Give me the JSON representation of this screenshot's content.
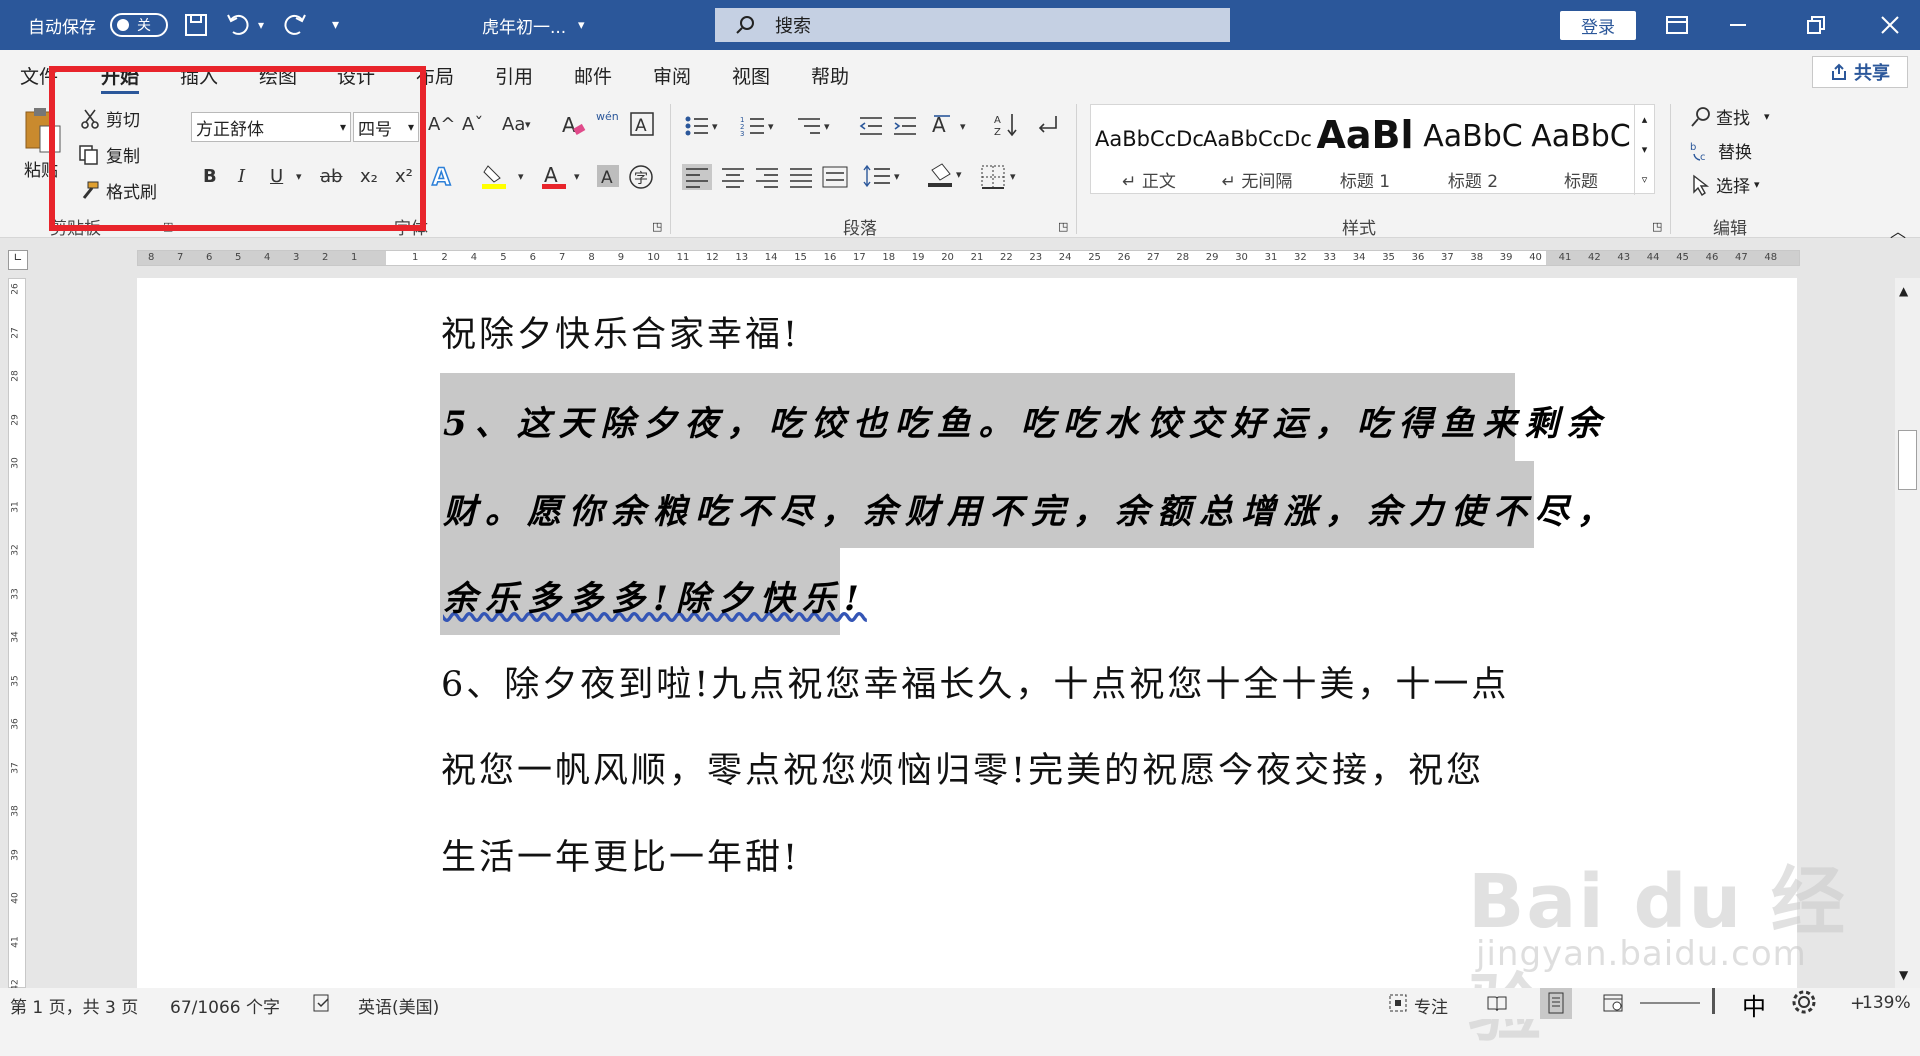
{
  "titlebar": {
    "autosave": "自动保存",
    "autosave_state": "关",
    "doc_title": "虎年初一...",
    "search_placeholder": "搜索",
    "login": "登录"
  },
  "tabs": [
    "文件",
    "开始",
    "插入",
    "绘图",
    "设计",
    "布局",
    "引用",
    "邮件",
    "审阅",
    "视图",
    "帮助"
  ],
  "share": "共享",
  "ribbon": {
    "clipboard": {
      "paste": "粘贴",
      "cut": "剪切",
      "copy": "复制",
      "format_painter": "格式刷",
      "label": "剪贴板"
    },
    "font": {
      "family": "方正舒体",
      "size": "四号",
      "label": "字体",
      "bold": "B",
      "italic": "I",
      "underline": "U",
      "strike": "ab",
      "subscript": "x₂",
      "superscript": "x²",
      "grow": "A^",
      "shrink": "Aˇ",
      "case": "Aa",
      "phonetic": "wén"
    },
    "paragraph": {
      "label": "段落"
    },
    "styles": {
      "label": "样式",
      "items": [
        {
          "sample": "AaBbCcDc",
          "name": "↵ 正文"
        },
        {
          "sample": "AaBbCcDc",
          "name": "↵ 无间隔"
        },
        {
          "sample": "AaBl",
          "name": "标题 1"
        },
        {
          "sample": "AaBbC",
          "name": "标题 2"
        },
        {
          "sample": "AaBbC",
          "name": "标题"
        }
      ]
    },
    "editing": {
      "find": "查找",
      "replace": "替换",
      "select": "选择",
      "label": "编辑"
    }
  },
  "ruler": {
    "h_left_ticks": [
      "8",
      "7",
      "6",
      "5",
      "4",
      "3",
      "2",
      "1"
    ],
    "h_ticks": [
      "1",
      "2",
      "4",
      "5",
      "6",
      "7",
      "8",
      "9",
      "10",
      "11",
      "12",
      "13",
      "14",
      "15",
      "16",
      "17",
      "18",
      "19",
      "20",
      "21",
      "22",
      "23",
      "24",
      "25",
      "26",
      "27",
      "28",
      "29",
      "30",
      "31",
      "32",
      "33",
      "34",
      "35",
      "36",
      "37",
      "38",
      "39",
      "40",
      "41",
      "42",
      "43",
      "44",
      "45",
      "46",
      "47",
      "48"
    ],
    "v_ticks": [
      "26",
      "27",
      "28",
      "29",
      "30",
      "31",
      "32",
      "33",
      "34",
      "35",
      "36",
      "37",
      "38",
      "39",
      "40",
      "41",
      "42"
    ]
  },
  "document": {
    "line1": "祝除夕快乐合家幸福!",
    "p5_line1": "5、这天除夕夜，吃饺也吃鱼。吃吃水饺交好运，吃得鱼来剩余",
    "p5_line2": "财。愿你余粮吃不尽，余财用不完，余额总增涨，余力使不尽，",
    "p5_line3": "余乐多多多!除夕快乐!",
    "p6_line1": "6、除夕夜到啦!九点祝您幸福长久，十点祝您十全十美，十一点",
    "p6_line2": "祝您一帆风顺，零点祝您烦恼归零!完美的祝愿今夜交接，祝您",
    "p6_line3": "生活一年更比一年甜!"
  },
  "status": {
    "page": "第 1 页，共 3 页",
    "words": "67/1066 个字",
    "language": "英语(美国)",
    "focus": "专注",
    "ime": "中",
    "zoom": "139%"
  },
  "watermark": {
    "brand": "Bai du 经验",
    "url": "jingyan.baidu.com"
  },
  "colors": {
    "accent": "#2b579a",
    "highlight_box": "#e8242b",
    "selection": "#c8c8c8"
  }
}
